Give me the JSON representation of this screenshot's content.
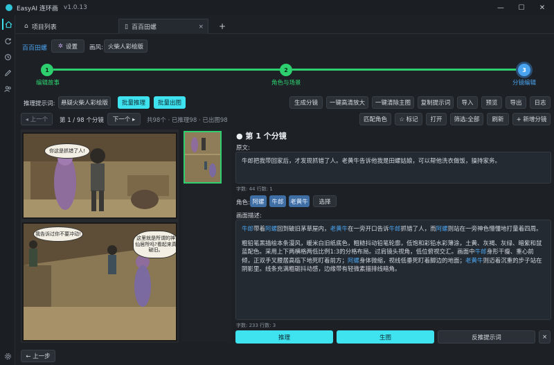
{
  "app": {
    "title": "EasyAI 连环画",
    "version": "v1.0.13"
  },
  "window_controls": {
    "min": "—",
    "max": "☐",
    "close": "✕"
  },
  "tabs": [
    {
      "label": "项目列表"
    },
    {
      "label": "百百田螺"
    }
  ],
  "tab_close": "×",
  "tab_add": "+",
  "header": {
    "project_name": "百百田螺",
    "settings_label": "设置",
    "style_label": "画风:",
    "style_value": "火柴人彩绘版"
  },
  "steps": [
    {
      "num": "1",
      "label": "编辑故事"
    },
    {
      "num": "2",
      "label": "角色与场景"
    },
    {
      "num": "3",
      "label": "分镜编辑"
    }
  ],
  "colors": {
    "accent_cyan": "#3fe3f0",
    "step_green": "#2ecf6e",
    "step_blue": "#4aa3ee",
    "chip_blue": "#3f6ea4"
  },
  "toolbar1": {
    "prompt_label": "推理提示词:",
    "prompt_value": "悬疑火柴人彩绘版",
    "batch_infer": "批量推理",
    "batch_image": "批量出图",
    "gen_storyboard": "生成分镜",
    "upscale": "一键高清放大",
    "clear_main": "一键清除主图",
    "copy_prompt": "复制提示词",
    "import": "导入",
    "preview": "预览",
    "export": "导出",
    "log": "日志"
  },
  "toolbar2": {
    "prev": "◂ 上一个",
    "page_info": "第 1 / 98 个分镜",
    "next": "下一个 ▸",
    "stats": "共98个 · 已推理98 · 已出图98",
    "match_char": "匹配角色",
    "mark": "☆ 标记",
    "open": "打开",
    "filter": "筛选:全部",
    "refresh": "刷新",
    "add_storyboard": "+ 新增分镜"
  },
  "comic": {
    "bubble1": "你这是抓错了人!",
    "bubble2": "我告诉过你不要冲动!",
    "bubble3": "这里就是所谓的神仙居所吗?看起来真破旧。"
  },
  "detail": {
    "heading": "● 第 1 个分镜",
    "original_label": "原文:",
    "original_text": "牛郎把我带回家后，才发现抓错了人。老黄牛告诉他我是田螺姑娘，可以帮他洗衣做饭，操持家务。",
    "original_stats": "字数: 44  行数: 1",
    "roles_label": "角色:",
    "roles": [
      "阿螺",
      "牛郎",
      "老黄牛"
    ],
    "select_label": "选择",
    "desc_label": "画面描述:",
    "desc_p1": [
      {
        "t": "牛郎",
        "n": true
      },
      {
        "t": "带着",
        "n": false
      },
      {
        "t": "阿螺",
        "n": true
      },
      {
        "t": "回到破旧茅草屋内，",
        "n": false
      },
      {
        "t": "老黄牛",
        "n": true
      },
      {
        "t": "在一旁开口告诉",
        "n": false
      },
      {
        "t": "牛郎",
        "n": true
      },
      {
        "t": "抓错了人，而",
        "n": false
      },
      {
        "t": "阿螺",
        "n": true
      },
      {
        "t": "则站在一旁神色懵懂地打量着四周。",
        "n": false
      }
    ],
    "desc_p2": [
      {
        "t": "粗铅笔黑描绘本条漫风，暖米白旧纸底色，粗糙抖动铅笔轮廓，低饱和彩铅水彩薄涂，土黄、灰褐、灰绿、暗紫和鼠蓝配色。采用上下两横格两低比例1:3的分格布局。过肩镜头视角，低位俯视交汇。画面中",
        "n": false
      },
      {
        "t": "牛郎",
        "n": true
      },
      {
        "t": "身形干瘦、重心前倾，正双手叉腰居高临下地死盯着前方；",
        "n": false
      },
      {
        "t": "阿螺",
        "n": true
      },
      {
        "t": "身体微缩，视线低垂死盯着脚边的地面；",
        "n": false
      },
      {
        "t": "老黄牛",
        "n": true
      },
      {
        "t": "则迈着沉重的步子站在阴影里。线条充满粗砺抖动感，边缘带有轻微素描排线暗角。",
        "n": false
      }
    ],
    "desc_stats": "字数: 233  行数: 3"
  },
  "actions": {
    "infer": "推理",
    "gen_image": "生图",
    "reverse_prompt": "反推提示词",
    "close": "×"
  },
  "footer": {
    "back": "← 上一步"
  }
}
